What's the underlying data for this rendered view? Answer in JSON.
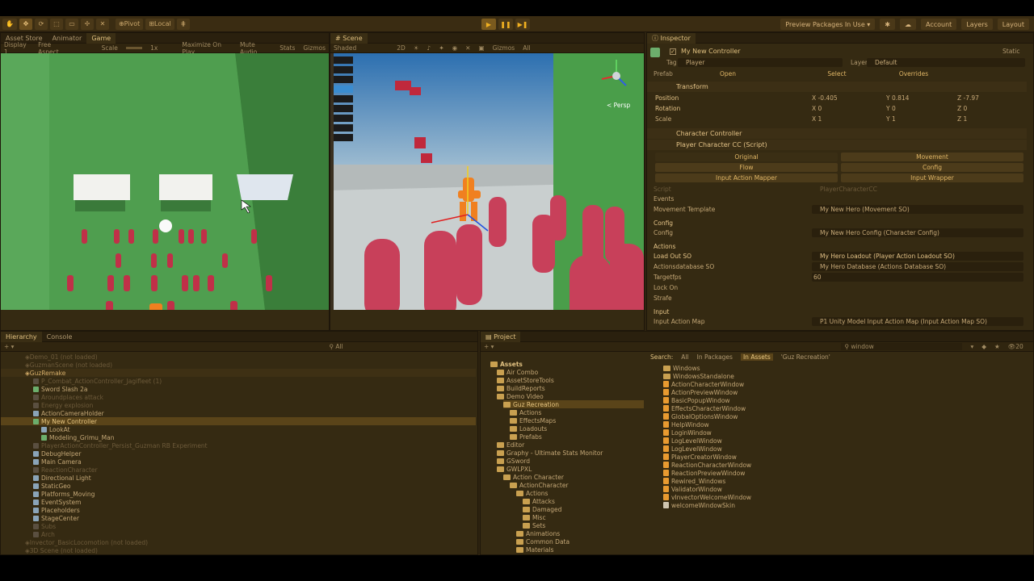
{
  "toolbar": {
    "pivot": "Pivot",
    "local": "Local",
    "preview_packages": "Preview Packages In Use ▾",
    "account": "Account",
    "layers": "Layers",
    "layout": "Layout"
  },
  "game_panel": {
    "tabs": [
      "Asset Store",
      "Animator",
      "Game"
    ],
    "display": "Display 1",
    "aspect": "Free Aspect",
    "scale_label": "Scale",
    "scale_value": "1x",
    "maximize": "Maximize On Play",
    "mute": "Mute Audio",
    "stats": "Stats",
    "gizmos": "Gizmos"
  },
  "scene_panel": {
    "tab": "Scene",
    "shaded": "Shaded",
    "mode_2d": "2D",
    "gizmos": "Gizmos",
    "all": "All",
    "persp": "< Persp"
  },
  "inspector": {
    "tab": "Inspector",
    "object_name": "My New Controller",
    "static": "Static",
    "tag_label": "Tag",
    "tag_value": "Player",
    "layer_label": "Layer",
    "layer_value": "Default",
    "prefab_label": "Prefab",
    "open": "Open",
    "select": "Select",
    "overrides": "Overrides",
    "transform": "Transform",
    "position_label": "Position",
    "rotation_label": "Rotation",
    "scale_label": "Scale",
    "pos": {
      "x": "-0.405",
      "y": "0.814",
      "z": "-7.97"
    },
    "rot": {
      "x": "0",
      "y": "0",
      "z": "0"
    },
    "scl": {
      "x": "1",
      "y": "1",
      "z": "1"
    },
    "char_controller": "Character Controller",
    "player_cc": "Player Character CC (Script)",
    "tabs_left": [
      "Original",
      "Flow",
      "Input Action Mapper"
    ],
    "tabs_right": [
      "Movement",
      "Config",
      "Input Wrapper"
    ],
    "script_label": "Script",
    "script_value": "PlayerCharacterCC",
    "events": "Events",
    "movement_template_label": "Movement Template",
    "movement_template_value": "My New Hero (Movement SO)",
    "config_header": "Config",
    "config_label": "Config",
    "config_value": "My New Hero Config (Character Config)",
    "actions_header": "Actions",
    "loadout_label": "Load Out SO",
    "loadout_value": "My Hero Loadout (Player Action Loadout SO)",
    "actionsdb_label": "Actionsdatabase SO",
    "actionsdb_value": "My Hero Database (Actions Database SO)",
    "targetfps_label": "Targetfps",
    "targetfps_value": "60",
    "lockon_label": "Lock On",
    "strafe_label": "Strafe",
    "input_header": "Input",
    "input_map_label": "Input Action Map",
    "input_map_value": "P1 Unity Model Input Action Map (Input Action Map SO)"
  },
  "hierarchy": {
    "tabs": [
      "Hierarchy",
      "Console"
    ],
    "search_placeholder": "All",
    "rows": [
      {
        "text": "Demo_01 (not loaded)",
        "style": "dim",
        "indent": 0,
        "icon": "none"
      },
      {
        "text": "GuzmanScene (not loaded)",
        "style": "dim",
        "indent": 0,
        "icon": "none"
      },
      {
        "text": "GuzRemake",
        "style": "scene",
        "indent": 0,
        "icon": "none"
      },
      {
        "text": "P_Combat_ActionController_Jagifleet (1)",
        "style": "dim",
        "indent": 1,
        "icon": "dim"
      },
      {
        "text": "Sword Slash 2a",
        "style": "normal",
        "indent": 1,
        "icon": "green"
      },
      {
        "text": "Aroundplaces attack",
        "style": "dim",
        "indent": 1,
        "icon": "dim"
      },
      {
        "text": "Energy explosion",
        "style": "dim",
        "indent": 1,
        "icon": "dim"
      },
      {
        "text": "ActionCameraHolder",
        "style": "normal",
        "indent": 1,
        "icon": "blue"
      },
      {
        "text": "My New Controller",
        "style": "sel",
        "indent": 1,
        "icon": "green"
      },
      {
        "text": "LookAt",
        "style": "normal",
        "indent": 2,
        "icon": "blue"
      },
      {
        "text": "Modeling_Grimu_Man",
        "style": "normal",
        "indent": 2,
        "icon": "green"
      },
      {
        "text": "PlayerActionController_Persist_Guzman RB Experiment",
        "style": "dim",
        "indent": 1,
        "icon": "dim"
      },
      {
        "text": "DebugHelper",
        "style": "normal",
        "indent": 1,
        "icon": "blue"
      },
      {
        "text": "Main Camera",
        "style": "normal",
        "indent": 1,
        "icon": "blue"
      },
      {
        "text": "ReactionCharacter",
        "style": "dim",
        "indent": 1,
        "icon": "dim"
      },
      {
        "text": "Directional Light",
        "style": "normal",
        "indent": 1,
        "icon": "blue"
      },
      {
        "text": "StaticGeo",
        "style": "normal",
        "indent": 1,
        "icon": "blue"
      },
      {
        "text": "Platforms_Moving",
        "style": "normal",
        "indent": 1,
        "icon": "blue"
      },
      {
        "text": "EventSystem",
        "style": "normal",
        "indent": 1,
        "icon": "blue"
      },
      {
        "text": "Placeholders",
        "style": "normal",
        "indent": 1,
        "icon": "blue"
      },
      {
        "text": "StageCenter",
        "style": "normal",
        "indent": 1,
        "icon": "blue"
      },
      {
        "text": "Subs",
        "style": "dim",
        "indent": 1,
        "icon": "dim"
      },
      {
        "text": "Arch",
        "style": "dim",
        "indent": 1,
        "icon": "dim"
      },
      {
        "text": "Invector_BasicLocomotion (not loaded)",
        "style": "dim",
        "indent": 0,
        "icon": "none"
      },
      {
        "text": "3D Scene (not loaded)",
        "style": "dim",
        "indent": 0,
        "icon": "none"
      }
    ]
  },
  "project": {
    "tab": "Project",
    "search_value": "window",
    "count": "20",
    "search_label": "Search:",
    "search_all": "All",
    "search_packages": "In Packages",
    "search_assets": "In Assets",
    "search_folder": "'Guz Recreation'",
    "tree": [
      {
        "text": "Assets",
        "indent": 0,
        "bold": true
      },
      {
        "text": "Air Combo",
        "indent": 1
      },
      {
        "text": "AssetStoreTools",
        "indent": 1
      },
      {
        "text": "BuildReports",
        "indent": 1
      },
      {
        "text": "Demo Video",
        "indent": 1
      },
      {
        "text": "Guz Recreation",
        "indent": 2,
        "sel": true
      },
      {
        "text": "Actions",
        "indent": 3
      },
      {
        "text": "EffectsMaps",
        "indent": 3
      },
      {
        "text": "Loadouts",
        "indent": 3
      },
      {
        "text": "Prefabs",
        "indent": 3
      },
      {
        "text": "Editor",
        "indent": 1
      },
      {
        "text": "Graphy - Ultimate Stats Monitor",
        "indent": 1
      },
      {
        "text": "GSword",
        "indent": 1
      },
      {
        "text": "GWLPXL",
        "indent": 1
      },
      {
        "text": "Action Character",
        "indent": 2
      },
      {
        "text": "ActionCharacter",
        "indent": 3
      },
      {
        "text": "Actions",
        "indent": 4
      },
      {
        "text": "Attacks",
        "indent": 5
      },
      {
        "text": "Damaged",
        "indent": 5
      },
      {
        "text": "Misc",
        "indent": 5
      },
      {
        "text": "Sets",
        "indent": 5
      },
      {
        "text": "Animations",
        "indent": 4
      },
      {
        "text": "Common Data",
        "indent": 4
      },
      {
        "text": "Materials",
        "indent": 4
      }
    ],
    "results": [
      {
        "text": "Windows",
        "type": "folder"
      },
      {
        "text": "WindowsStandalone",
        "type": "folder"
      },
      {
        "text": "ActionCharacterWindow",
        "type": "file"
      },
      {
        "text": "ActionPreviewWindow",
        "type": "file"
      },
      {
        "text": "BasicPopupWindow",
        "type": "file"
      },
      {
        "text": "EffectsCharacterWindow",
        "type": "file"
      },
      {
        "text": "GlobalOptionsWindow",
        "type": "file"
      },
      {
        "text": "HelpWindow",
        "type": "file"
      },
      {
        "text": "LoginWindow",
        "type": "file"
      },
      {
        "text": "LogLevelWindow",
        "type": "file"
      },
      {
        "text": "LogLevelWindow",
        "type": "file"
      },
      {
        "text": "PlayerCreatorWindow",
        "type": "file"
      },
      {
        "text": "ReactionCharacterWindow",
        "type": "file"
      },
      {
        "text": "ReactionPreviewWindow",
        "type": "file"
      },
      {
        "text": "Rewired_Windows",
        "type": "file"
      },
      {
        "text": "ValidatorWindow",
        "type": "file"
      },
      {
        "text": "vInvectorWelcomeWindow",
        "type": "file"
      },
      {
        "text": "welcomeWindowSkin",
        "type": "white"
      }
    ]
  },
  "colors": {
    "accent": "#e8c07a",
    "play": "#f0b020",
    "ground": "#3d8a3e",
    "capsule": "#c03048"
  }
}
